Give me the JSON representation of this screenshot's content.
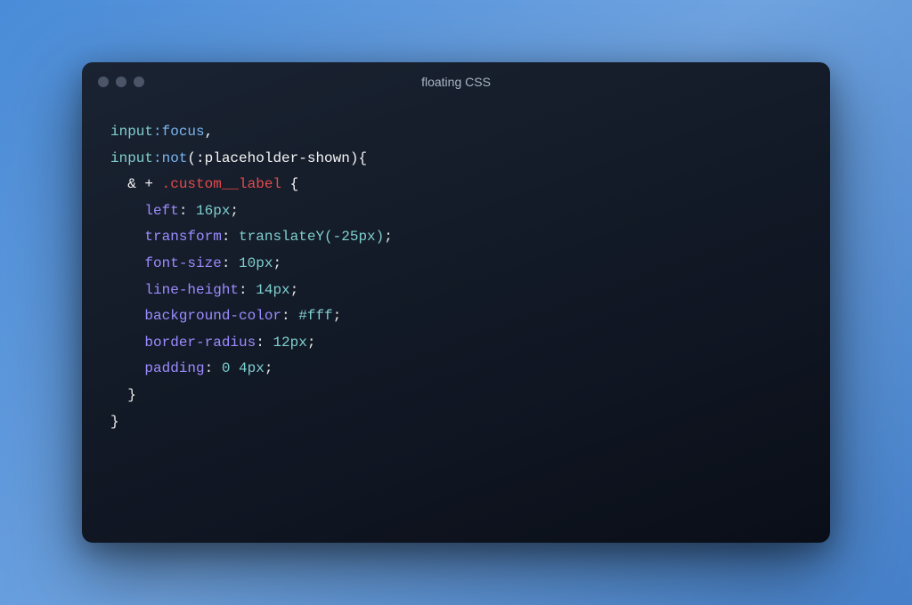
{
  "window": {
    "title": "floating CSS"
  },
  "code": {
    "lines": [
      {
        "indent": 0,
        "tokens": [
          {
            "cls": "token-tag",
            "text": "input"
          },
          {
            "cls": "token-pseudo",
            "text": ":focus"
          },
          {
            "cls": "token-white",
            "text": ","
          }
        ]
      },
      {
        "indent": 0,
        "tokens": [
          {
            "cls": "token-tag",
            "text": "input"
          },
          {
            "cls": "token-pseudo",
            "text": ":not"
          },
          {
            "cls": "token-white",
            "text": "(:placeholder-shown){"
          }
        ]
      },
      {
        "indent": 1,
        "tokens": [
          {
            "cls": "token-white",
            "text": "& + "
          },
          {
            "cls": "token-class",
            "text": ".custom__label "
          },
          {
            "cls": "token-white",
            "text": "{"
          }
        ]
      },
      {
        "indent": 2,
        "tokens": [
          {
            "cls": "token-prop",
            "text": "left"
          },
          {
            "cls": "token-punct",
            "text": ": "
          },
          {
            "cls": "token-value",
            "text": "16px"
          },
          {
            "cls": "token-punct",
            "text": ";"
          }
        ]
      },
      {
        "indent": 2,
        "tokens": [
          {
            "cls": "token-prop",
            "text": "transform"
          },
          {
            "cls": "token-punct",
            "text": ": "
          },
          {
            "cls": "token-value",
            "text": "translateY(-25px)"
          },
          {
            "cls": "token-punct",
            "text": ";"
          }
        ]
      },
      {
        "indent": 2,
        "tokens": [
          {
            "cls": "token-prop",
            "text": "font-size"
          },
          {
            "cls": "token-punct",
            "text": ": "
          },
          {
            "cls": "token-value",
            "text": "10px"
          },
          {
            "cls": "token-punct",
            "text": ";"
          }
        ]
      },
      {
        "indent": 2,
        "tokens": [
          {
            "cls": "token-prop",
            "text": "line-height"
          },
          {
            "cls": "token-punct",
            "text": ": "
          },
          {
            "cls": "token-value",
            "text": "14px"
          },
          {
            "cls": "token-punct",
            "text": ";"
          }
        ]
      },
      {
        "indent": 2,
        "tokens": [
          {
            "cls": "token-prop",
            "text": "background-color"
          },
          {
            "cls": "token-punct",
            "text": ": "
          },
          {
            "cls": "token-value",
            "text": "#fff"
          },
          {
            "cls": "token-punct",
            "text": ";"
          }
        ]
      },
      {
        "indent": 2,
        "tokens": [
          {
            "cls": "token-prop",
            "text": "border-radius"
          },
          {
            "cls": "token-punct",
            "text": ": "
          },
          {
            "cls": "token-value",
            "text": "12px"
          },
          {
            "cls": "token-punct",
            "text": ";"
          }
        ]
      },
      {
        "indent": 2,
        "tokens": [
          {
            "cls": "token-prop",
            "text": "padding"
          },
          {
            "cls": "token-punct",
            "text": ": "
          },
          {
            "cls": "token-value",
            "text": "0 4px"
          },
          {
            "cls": "token-punct",
            "text": ";"
          }
        ]
      },
      {
        "indent": 1,
        "tokens": [
          {
            "cls": "token-brace",
            "text": "}"
          }
        ]
      },
      {
        "indent": 0,
        "tokens": [
          {
            "cls": "token-brace",
            "text": "}"
          }
        ]
      }
    ]
  }
}
